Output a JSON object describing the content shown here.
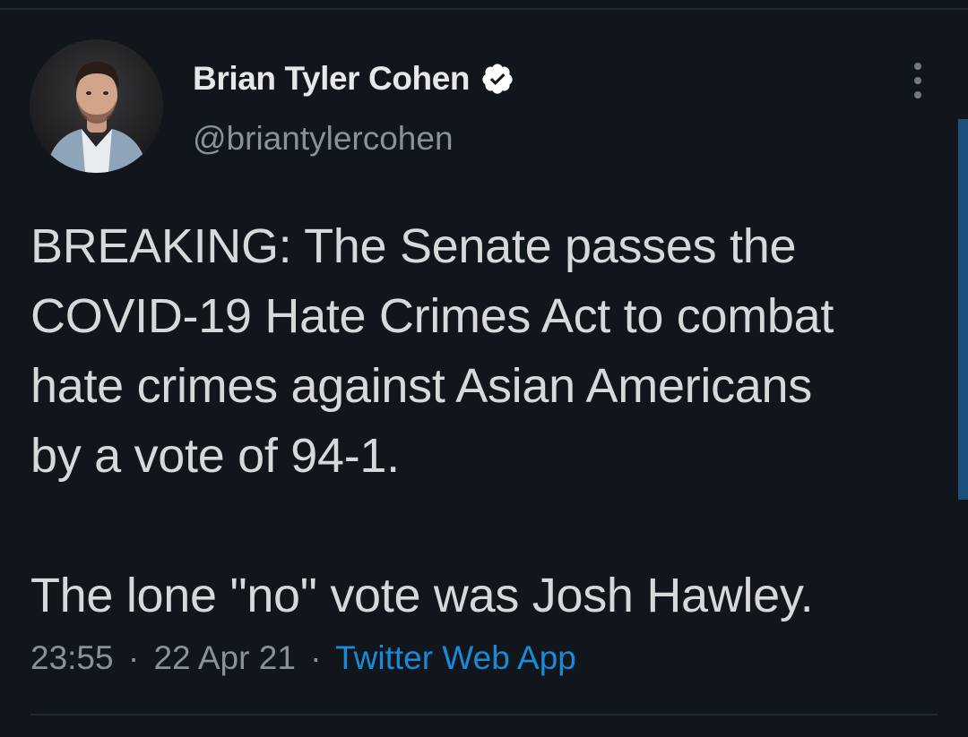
{
  "tweet": {
    "author": {
      "name": "Brian Tyler Cohen",
      "handle": "@briantylercohen",
      "verified": true,
      "avatar_icon": "profile-photo"
    },
    "text_lines": [
      "BREAKING: The Senate passes the",
      "COVID-19 Hate Crimes Act to combat",
      "hate crimes against Asian Americans",
      "by a vote of 94-1."
    ],
    "text_lines_2": [
      "The lone \"no\" vote was Josh Hawley."
    ],
    "time": "23:55",
    "date": "22 Apr 21",
    "separator": "·",
    "source": "Twitter Web App",
    "more_icon": "more-vertical-icon"
  },
  "colors": {
    "background": "#11161d",
    "text": "#d7d8da",
    "secondary_text": "#8a9198",
    "link": "#1a8ad6",
    "verified_badge": "#ffffff"
  }
}
